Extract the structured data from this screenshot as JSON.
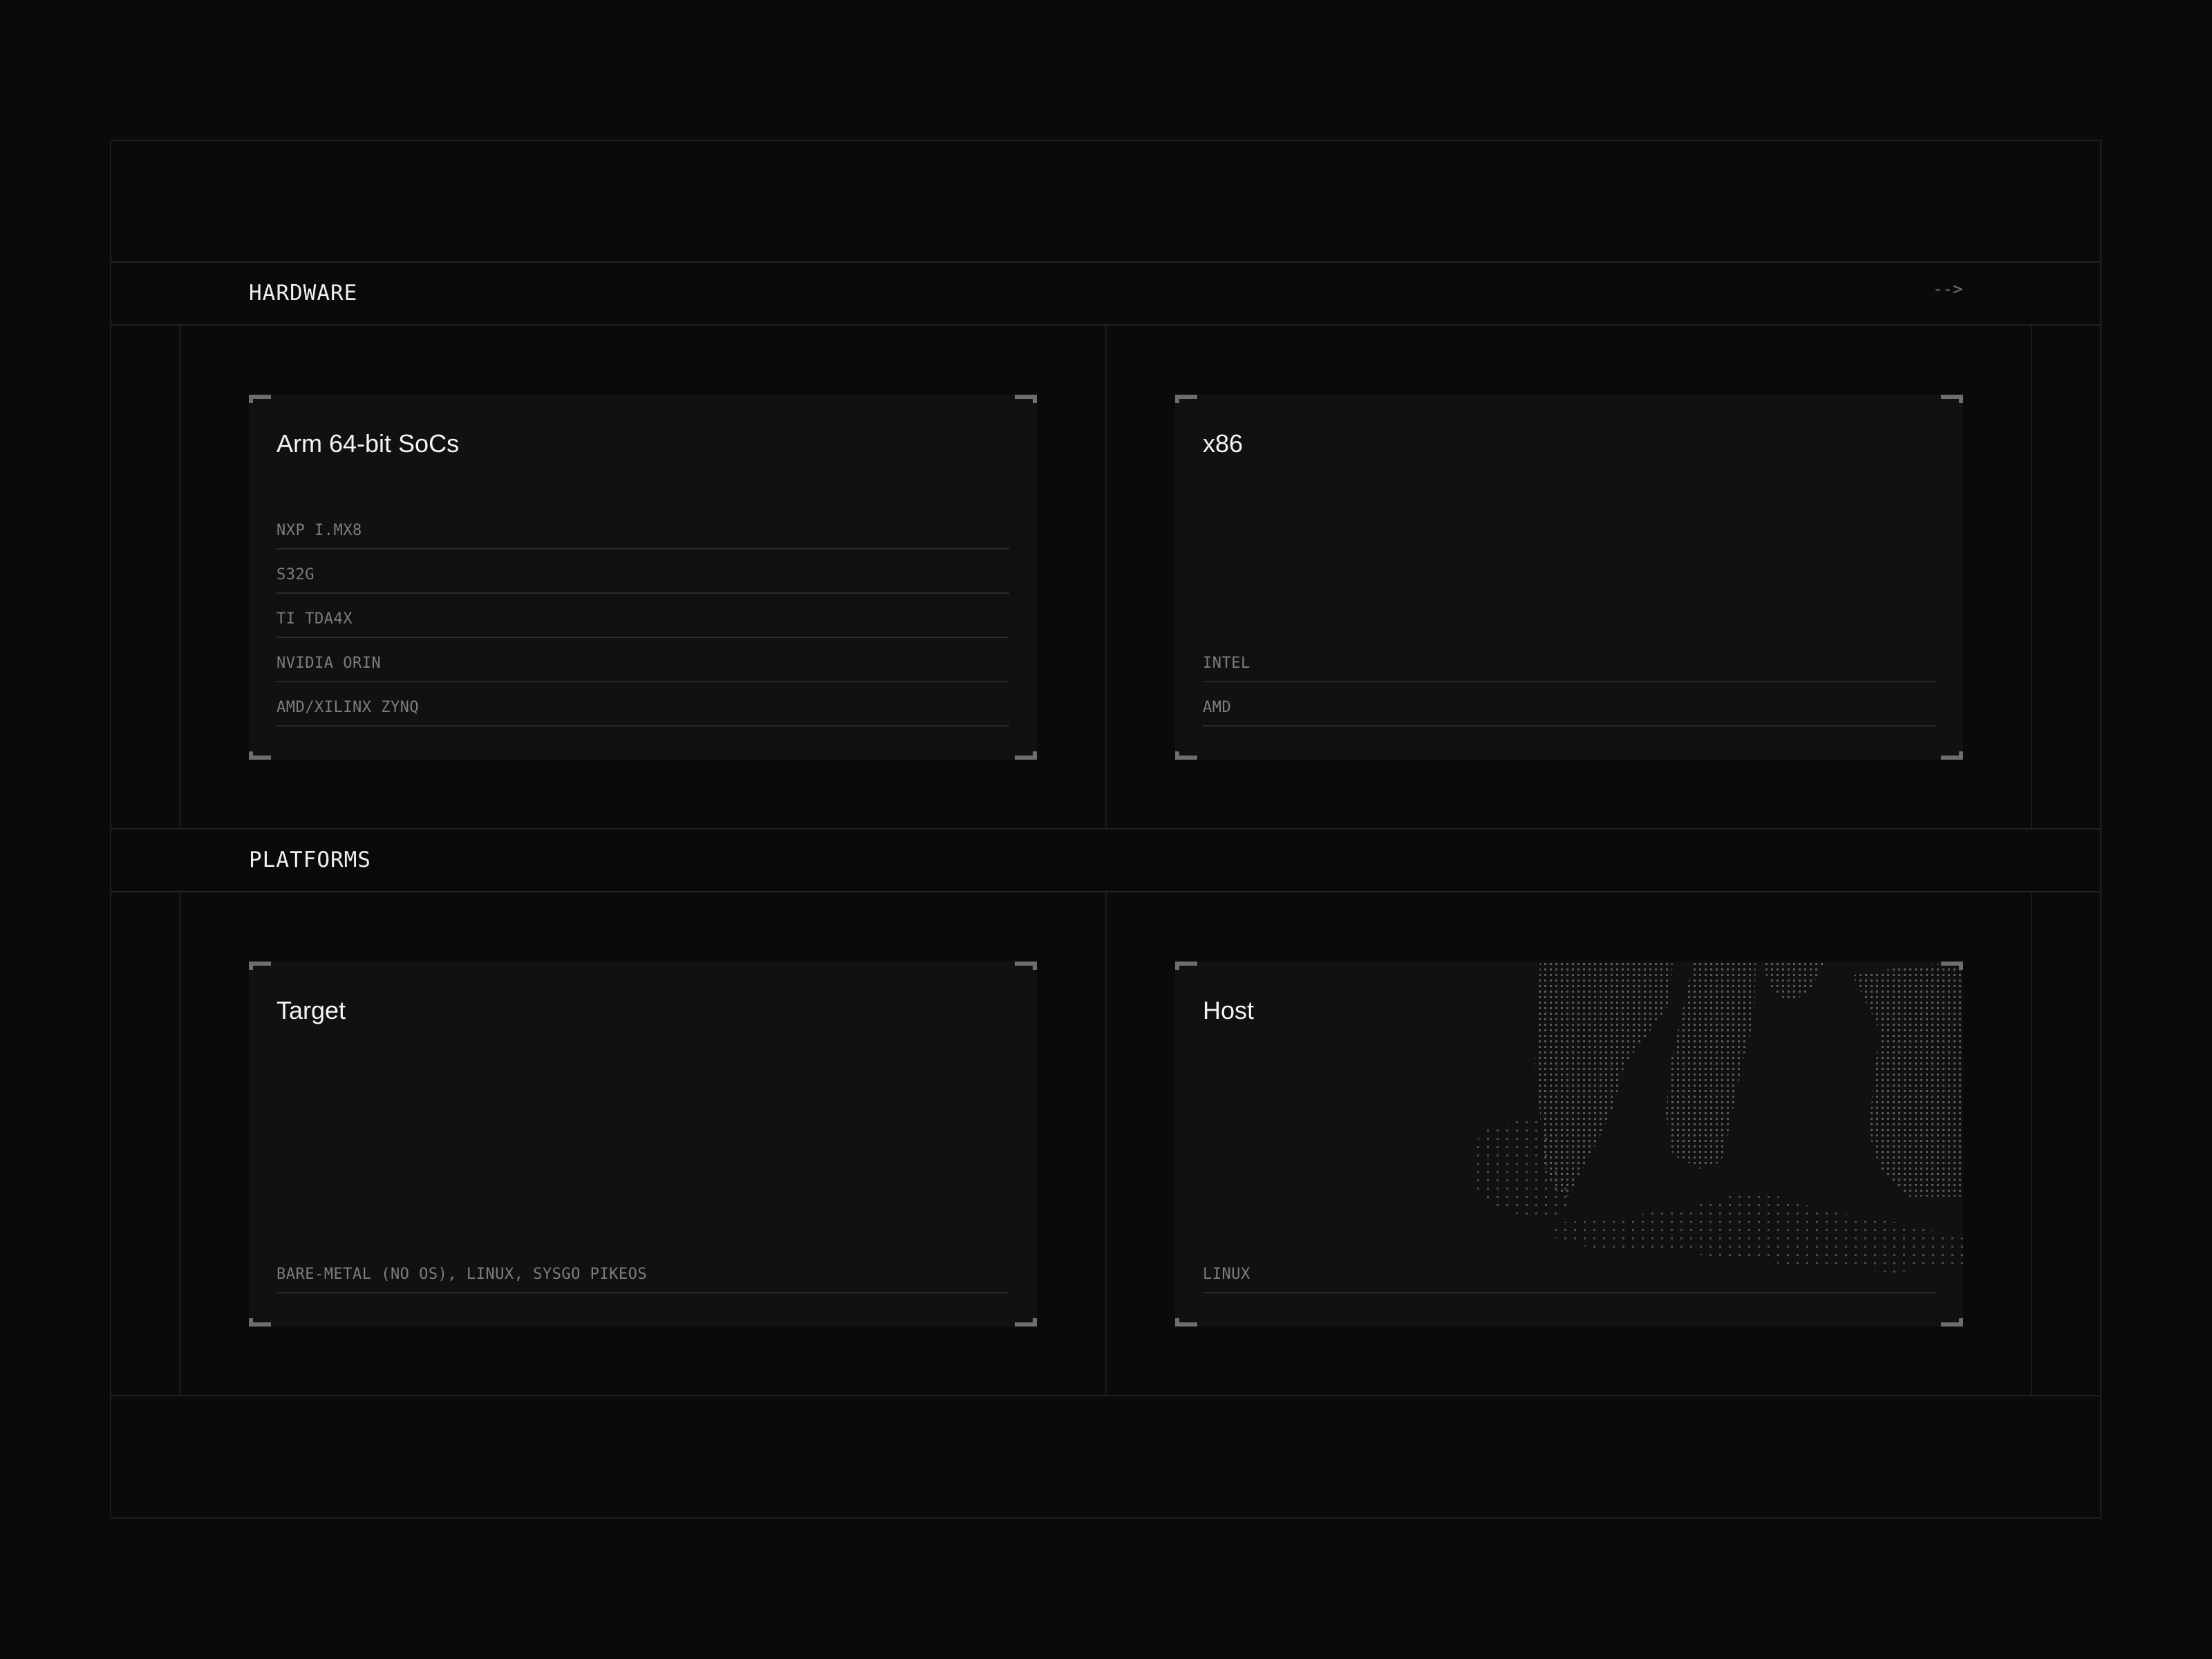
{
  "sections": {
    "hardware": {
      "label": "HARDWARE",
      "arrow": "-->",
      "cards": [
        {
          "title": "Arm 64-bit SoCs",
          "items": [
            "NXP I.MX8",
            "S32G",
            "TI TDA4X",
            "NVIDIA ORIN",
            "AMD/XILINX ZYNQ"
          ]
        },
        {
          "title": "x86",
          "items": [
            "INTEL",
            "AMD"
          ]
        }
      ]
    },
    "platforms": {
      "label": "PLATFORMS",
      "cards": [
        {
          "title": "Target",
          "items": [
            "BARE-METAL (NO OS), LINUX, SYSGO PIKEOS"
          ]
        },
        {
          "title": "Host",
          "items": [
            "LINUX"
          ],
          "graphic": "dotted-map-pattern"
        }
      ]
    }
  },
  "colors": {
    "background": "#0a0a0a",
    "card": "#111111",
    "border": "#222222",
    "muted_text": "#7d7d7d",
    "corner": "#6e6e6e"
  }
}
